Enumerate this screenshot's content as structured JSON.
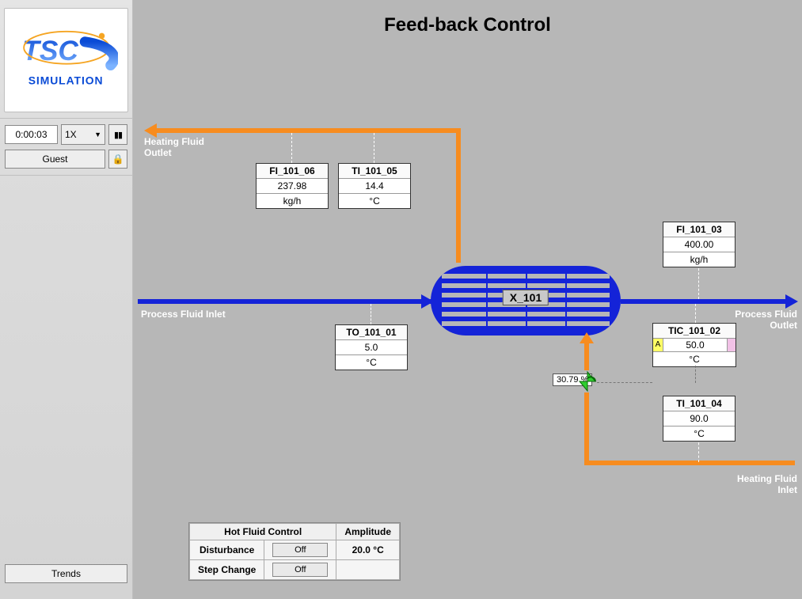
{
  "title": "Feed-back Control",
  "sidebar": {
    "clock": "0:00:03",
    "speed": "1X",
    "user": "Guest",
    "trends": "Trends"
  },
  "labels": {
    "heating_outlet_1": "Heating Fluid",
    "heating_outlet_2": "Outlet",
    "process_inlet": "Process Fluid Inlet",
    "process_outlet_1": "Process Fluid",
    "process_outlet_2": "Outlet",
    "heating_inlet_1": "Heating Fluid",
    "heating_inlet_2": "Inlet"
  },
  "exchanger": {
    "name": "X_101"
  },
  "valve": {
    "percent": "30.79 %"
  },
  "tags": {
    "FI_101_06": {
      "id": "FI_101_06",
      "value": "237.98",
      "unit": "kg/h"
    },
    "TI_101_05": {
      "id": "TI_101_05",
      "value": "14.4",
      "unit": "°C"
    },
    "TO_101_01": {
      "id": "TO_101_01",
      "value": "5.0",
      "unit": "°C"
    },
    "FI_101_03": {
      "id": "FI_101_03",
      "value": "400.00",
      "unit": "kg/h"
    },
    "TIC_101_02": {
      "id": "TIC_101_02",
      "value": "50.0",
      "unit": "°C",
      "mode": "A"
    },
    "TI_101_04": {
      "id": "TI_101_04",
      "value": "90.0",
      "unit": "°C"
    }
  },
  "hot_fluid": {
    "header_control": "Hot Fluid Control",
    "header_amp": "Amplitude",
    "row1_label": "Disturbance",
    "row1_state": "Off",
    "row1_amp": "20.0 °C",
    "row2_label": "Step Change",
    "row2_state": "Off"
  }
}
